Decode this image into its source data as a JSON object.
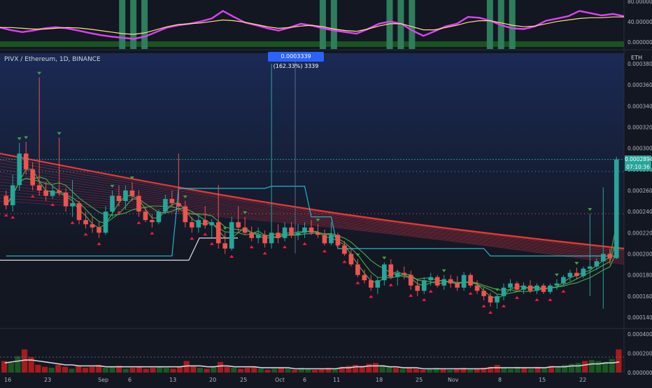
{
  "chart_title": "PIVX / Ethereum, 1D, BINANCE",
  "axis_unit": "ETH",
  "tooltip": "0.0003339 (162.33%) 3339",
  "last_price": "0.0002894",
  "countdown": "07:10:36",
  "colors": {
    "bg": "#131722",
    "bg_top": "#1a2a55",
    "up": "#26a69a",
    "down": "#ef5350",
    "ribbon_fast": "#4caf50",
    "ribbon_slow": "#e53935",
    "trail": "#26c6da",
    "osc": "#e040fb",
    "osc_sig": "#ffe082",
    "vol_ma": "#d1d4dc"
  },
  "chart_data": [
    {
      "type": "line",
      "name": "oscillator",
      "y_ticks": [
        "80.000000",
        "40.000000",
        "0.000000"
      ],
      "ylim": [
        0,
        100
      ],
      "series": [
        {
          "values": [
            42,
            35,
            30,
            34,
            40,
            43,
            40,
            34,
            28,
            22,
            18,
            15,
            12,
            18,
            30,
            42,
            48,
            52,
            58,
            66,
            86,
            70,
            55,
            48,
            40,
            34,
            42,
            52,
            47,
            40,
            34,
            30,
            26,
            38,
            52,
            58,
            52,
            34,
            20,
            32,
            45,
            52,
            70,
            68,
            60,
            48,
            40,
            38,
            45,
            60,
            66,
            72,
            86,
            80,
            74,
            78,
            72
          ]
        },
        {
          "values": [
            42,
            42,
            40,
            38,
            38,
            40,
            42,
            41,
            38,
            34,
            30,
            26,
            24,
            28,
            36,
            44,
            50,
            52,
            54,
            58,
            62,
            60,
            56,
            50,
            44,
            40,
            42,
            46,
            48,
            44,
            38,
            34,
            32,
            38,
            46,
            52,
            52,
            44,
            36,
            36,
            42,
            48,
            56,
            60,
            60,
            54,
            48,
            44,
            46,
            52,
            58,
            62,
            66,
            68,
            68,
            70,
            70
          ]
        }
      ],
      "signal_bars": [
        11,
        12,
        13,
        29,
        30,
        35,
        36,
        37,
        44,
        45,
        46
      ]
    },
    {
      "type": "candlestick",
      "name": "price",
      "x_tick_labels": [
        "16",
        "23",
        "Sep",
        "6",
        "13",
        "20",
        "25",
        "Oct",
        "6",
        "11",
        "18",
        "25",
        "Nov",
        "8",
        "15",
        "22"
      ],
      "y_ticks": [
        "0.0003800",
        "0.0003600",
        "0.0003400",
        "0.0003200",
        "0.0003000",
        "0.0002800",
        "0.0002600",
        "0.0002400",
        "0.0002200",
        "0.0002000",
        "0.0001800",
        "0.0001600",
        "0.0001400"
      ],
      "ylim": [
        0.00013,
        0.00039
      ],
      "candles": [
        [
          0.000255,
          0.00026,
          0.000242,
          0.000246
        ],
        [
          0.000246,
          0.000275,
          0.00024,
          0.000265
        ],
        [
          0.000265,
          0.000305,
          0.00026,
          0.000295
        ],
        [
          0.000295,
          0.000306,
          0.000275,
          0.00028
        ],
        [
          0.00028,
          0.000287,
          0.00026,
          0.000265
        ],
        [
          0.000265,
          0.000367,
          0.000255,
          0.00026
        ],
        [
          0.00026,
          0.000268,
          0.00025,
          0.000255
        ],
        [
          0.000255,
          0.000265,
          0.000252,
          0.00026
        ],
        [
          0.00026,
          0.00031,
          0.000255,
          0.000258
        ],
        [
          0.000258,
          0.000262,
          0.00024,
          0.000245
        ],
        [
          0.000245,
          0.00027,
          0.000235,
          0.000248
        ],
        [
          0.000248,
          0.00025,
          0.000228,
          0.000232
        ],
        [
          0.000232,
          0.00024,
          0.000224,
          0.000228
        ],
        [
          0.000228,
          0.000235,
          0.00022,
          0.000225
        ],
        [
          0.000225,
          0.00023,
          0.000215,
          0.00022
        ],
        [
          0.00022,
          0.000245,
          0.000218,
          0.00024
        ],
        [
          0.00024,
          0.00026,
          0.000235,
          0.000255
        ],
        [
          0.000255,
          0.000265,
          0.000245,
          0.00025
        ],
        [
          0.00025,
          0.000265,
          0.000242,
          0.00026
        ],
        [
          0.00026,
          0.000268,
          0.00025,
          0.000255
        ],
        [
          0.000255,
          0.00026,
          0.000235,
          0.00024
        ],
        [
          0.00024,
          0.000245,
          0.00023,
          0.000232
        ],
        [
          0.000232,
          0.000238,
          0.000225,
          0.00023
        ],
        [
          0.00023,
          0.000242,
          0.000228,
          0.00024
        ],
        [
          0.00024,
          0.000256,
          0.000238,
          0.000252
        ],
        [
          0.000252,
          0.00026,
          0.000245,
          0.000248
        ],
        [
          0.000248,
          0.000295,
          0.00024,
          0.000245
        ],
        [
          0.000245,
          0.00025,
          0.000225,
          0.00023
        ],
        [
          0.00023,
          0.000235,
          0.00022,
          0.000225
        ],
        [
          0.000225,
          0.000238,
          0.00022,
          0.000232
        ],
        [
          0.000232,
          0.000245,
          0.000224,
          0.000227
        ],
        [
          0.000227,
          0.000233,
          0.000215,
          0.00023
        ],
        [
          0.00023,
          0.000265,
          0.000205,
          0.00021
        ],
        [
          0.00021,
          0.00022,
          0.0002,
          0.000205
        ],
        [
          0.000205,
          0.000235,
          0.000203,
          0.00023
        ],
        [
          0.00023,
          0.000245,
          0.00022,
          0.000225
        ],
        [
          0.000225,
          0.000235,
          0.000218,
          0.00022
        ],
        [
          0.00022,
          0.000226,
          0.000212,
          0.000215
        ],
        [
          0.000215,
          0.000225,
          0.00021,
          0.000218
        ],
        [
          0.000218,
          0.000222,
          0.000206,
          0.00021
        ],
        [
          0.00021,
          0.00038,
          0.000205,
          0.00022
        ],
        [
          0.00022,
          0.000228,
          0.00021,
          0.000215
        ],
        [
          0.000215,
          0.00023,
          0.000212,
          0.000225
        ],
        [
          0.000225,
          0.00023,
          0.000215,
          0.000218
        ],
        [
          0.000218,
          0.000228,
          0.000213,
          0.00022
        ],
        [
          0.00022,
          0.00023,
          0.000215,
          0.000225
        ],
        [
          0.000225,
          0.000232,
          0.000218,
          0.00022
        ],
        [
          0.00022,
          0.000228,
          0.000215,
          0.000218
        ],
        [
          0.000218,
          0.000223,
          0.000208,
          0.00021
        ],
        [
          0.00021,
          0.00023,
          0.000208,
          0.000218
        ],
        [
          0.000218,
          0.00022,
          0.000205,
          0.000208
        ],
        [
          0.000208,
          0.000212,
          0.000198,
          0.0002
        ],
        [
          0.0002,
          0.000205,
          0.000188,
          0.00019
        ],
        [
          0.00019,
          0.000195,
          0.000178,
          0.00018
        ],
        [
          0.00018,
          0.000185,
          0.000172,
          0.000175
        ],
        [
          0.000175,
          0.00018,
          0.000165,
          0.000168
        ],
        [
          0.000168,
          0.000178,
          0.000162,
          0.000175
        ],
        [
          0.000175,
          0.000192,
          0.00017,
          0.00019
        ],
        [
          0.00019,
          0.000195,
          0.000176,
          0.000178
        ],
        [
          0.000178,
          0.000185,
          0.00017,
          0.000182
        ],
        [
          0.000182,
          0.000188,
          0.000176,
          0.00018
        ],
        [
          0.00018,
          0.000184,
          0.000166,
          0.00017
        ],
        [
          0.00017,
          0.000176,
          0.00016,
          0.000165
        ],
        [
          0.000165,
          0.000178,
          0.000162,
          0.000175
        ],
        [
          0.000175,
          0.000182,
          0.00017,
          0.000178
        ],
        [
          0.000178,
          0.00018,
          0.000168,
          0.00017
        ],
        [
          0.00017,
          0.00018,
          0.000166,
          0.000176
        ],
        [
          0.000176,
          0.00018,
          0.000168,
          0.000172
        ],
        [
          0.000172,
          0.000179,
          0.000165,
          0.000168
        ],
        [
          0.000168,
          0.000183,
          0.000165,
          0.00018
        ],
        [
          0.00018,
          0.000182,
          0.000168,
          0.00017
        ],
        [
          0.00017,
          0.000175,
          0.000162,
          0.000165
        ],
        [
          0.000165,
          0.000168,
          0.000156,
          0.00016
        ],
        [
          0.00016,
          0.000163,
          0.00015,
          0.000154
        ],
        [
          0.000154,
          0.000162,
          0.000148,
          0.00016
        ],
        [
          0.00016,
          0.000172,
          0.000156,
          0.000168
        ],
        [
          0.000168,
          0.000176,
          0.000164,
          0.000172
        ],
        [
          0.000172,
          0.000174,
          0.000164,
          0.000166
        ],
        [
          0.000166,
          0.000173,
          0.000162,
          0.00017
        ],
        [
          0.00017,
          0.000175,
          0.000163,
          0.000165
        ],
        [
          0.000165,
          0.000172,
          0.000162,
          0.00017
        ],
        [
          0.00017,
          0.000172,
          0.000162,
          0.000164
        ],
        [
          0.000164,
          0.000172,
          0.000162,
          0.00017
        ],
        [
          0.00017,
          0.000176,
          0.000166,
          0.000172
        ],
        [
          0.000172,
          0.00018,
          0.00017,
          0.000178
        ],
        [
          0.000178,
          0.000185,
          0.000174,
          0.000182
        ],
        [
          0.000182,
          0.000187,
          0.000176,
          0.000179
        ],
        [
          0.000179,
          0.000188,
          0.000177,
          0.000186
        ],
        [
          0.000186,
          0.000238,
          0.00016,
          0.000188
        ],
        [
          0.000188,
          0.000196,
          0.000185,
          0.000193
        ],
        [
          0.000193,
          0.000263,
          0.000148,
          0.0002
        ],
        [
          0.0002,
          0.000205,
          0.00019,
          0.000196
        ],
        [
          0.000196,
          0.000292,
          0.000195,
          0.0002894
        ]
      ],
      "ribbon_start": [
        0.000295,
        0.000292,
        0.000289,
        0.000286,
        0.000283,
        0.00028,
        0.000277,
        0.000274,
        0.000271,
        0.000268,
        0.000265,
        0.000262,
        0.000259,
        0.000256,
        0.000253,
        0.00025
      ],
      "ribbon_end": [
        0.000205,
        0.000204,
        0.000203,
        0.000202,
        0.000201,
        0.0002,
        0.000199,
        0.000198,
        0.000197,
        0.000196,
        0.000195,
        0.000194,
        0.000193,
        0.000192,
        0.000191,
        0.00019
      ],
      "dotted_levels": [
        0.000278,
        0.000238
      ],
      "sell_marks": [
        2,
        3,
        5,
        8,
        16,
        19,
        27,
        33,
        36,
        40,
        47,
        53,
        57,
        66,
        74,
        83,
        86,
        88
      ],
      "buy_marks": [
        0,
        1,
        4,
        7,
        10,
        12,
        14,
        17,
        20,
        22,
        28,
        30,
        31,
        34,
        37,
        39,
        42,
        45,
        48,
        51,
        53,
        55,
        58,
        61,
        63,
        64,
        70,
        72,
        73,
        75,
        77,
        80,
        82,
        84
      ]
    },
    {
      "type": "bar",
      "name": "volume",
      "y_ticks": [
        "0.0004000",
        "0.0002000",
        "0.0000000"
      ],
      "ylim": [
        0,
        0.00045
      ],
      "values": [
        0.00012,
        0.0001,
        0.00017,
        0.00024,
        0.00016,
        8e-05,
        6e-05,
        5e-05,
        8e-05,
        6e-05,
        4e-05,
        7e-05,
        5e-05,
        6e-05,
        8e-05,
        5e-05,
        6e-05,
        7e-05,
        4e-05,
        5e-05,
        6e-05,
        4e-05,
        5e-05,
        6e-05,
        5e-05,
        4e-05,
        6e-05,
        0.00012,
        7e-05,
        5e-05,
        4e-05,
        6e-05,
        0.00011,
        6e-05,
        5e-05,
        4e-05,
        5e-05,
        6e-05,
        4e-05,
        3e-05,
        4e-05,
        5e-05,
        4e-05,
        3e-05,
        5e-05,
        4e-05,
        3e-05,
        4e-05,
        5e-05,
        4e-05,
        6e-05,
        7e-05,
        8e-05,
        7e-05,
        9e-05,
        0.0001,
        8e-05,
        6e-05,
        5e-05,
        4e-05,
        5e-05,
        4e-05,
        3e-05,
        4e-05,
        5e-05,
        4e-05,
        3e-05,
        4e-05,
        5e-05,
        4e-05,
        4e-05,
        5e-05,
        6e-05,
        8e-05,
        5e-05,
        4e-05,
        6e-05,
        5e-05,
        4e-05,
        6e-05,
        5e-05,
        7e-05,
        6e-05,
        8e-05,
        9e-05,
        0.0001,
        0.00012,
        0.00013,
        0.00012,
        0.00011,
        0.00014,
        0.00024
      ],
      "ma": [
        0.0001,
        0.00011,
        0.00012,
        0.00013,
        0.00013,
        0.00012,
        0.00011,
        0.0001,
        9e-05,
        8e-05,
        8e-05,
        7e-05,
        7e-05,
        7e-05,
        7e-05,
        6e-05,
        6e-05,
        6e-05,
        6e-05,
        6e-05,
        6e-05,
        6e-05,
        6e-05,
        6e-05,
        6e-05,
        6e-05,
        6e-05,
        7e-05,
        7e-05,
        7e-05,
        6e-05,
        6e-05,
        7e-05,
        7e-05,
        6e-05,
        6e-05,
        6e-05,
        6e-05,
        5e-05,
        5e-05,
        5e-05,
        5e-05,
        5e-05,
        4e-05,
        4e-05,
        4e-05,
        4e-05,
        4e-05,
        4e-05,
        4e-05,
        5e-05,
        5e-05,
        6e-05,
        6e-05,
        7e-05,
        7e-05,
        7e-05,
        6e-05,
        6e-05,
        5e-05,
        5e-05,
        5e-05,
        4e-05,
        4e-05,
        4e-05,
        4e-05,
        4e-05,
        4e-05,
        4e-05,
        4e-05,
        4e-05,
        4e-05,
        5e-05,
        5e-05,
        5e-05,
        5e-05,
        5e-05,
        5e-05,
        5e-05,
        5e-05,
        5e-05,
        6e-05,
        6e-05,
        6e-05,
        7e-05,
        7e-05,
        8e-05,
        9e-05,
        9e-05,
        0.0001,
        0.0001,
        0.00011
      ]
    }
  ]
}
